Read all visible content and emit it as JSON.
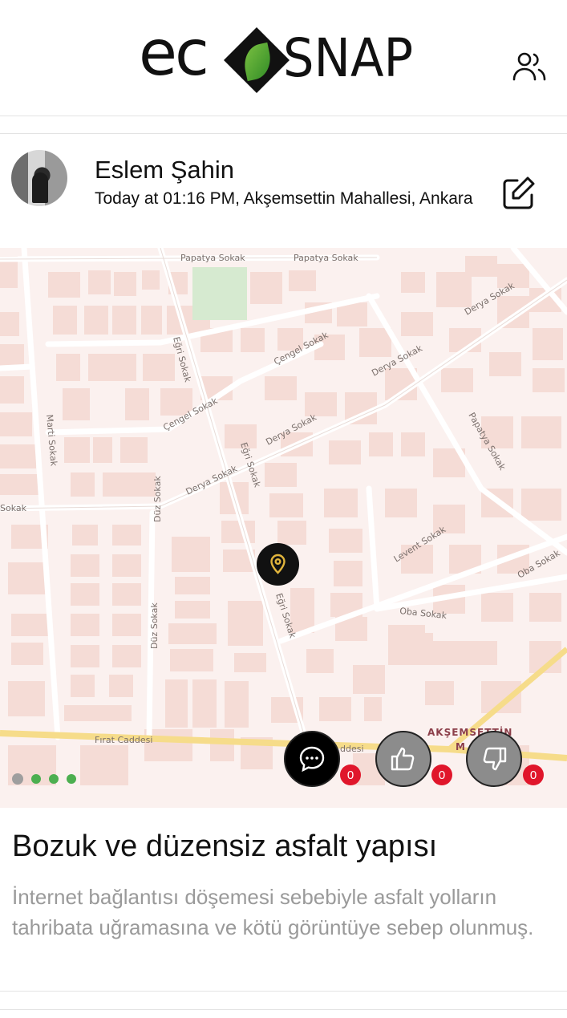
{
  "app": {
    "logo_text": "ecoSNAP"
  },
  "header": {
    "users_icon": "users-icon"
  },
  "post": {
    "author": "Eslem Şahin",
    "meta": "Today at 01:16 PM, Akşemsettin Mahallesi, Ankara",
    "edit_icon": "edit-icon",
    "title": "Bozuk ve düzensiz asfalt yapısı",
    "description": "İnternet bağlantısı döşemesi sebebiyle asfalt yolların tahribata uğramasına ve kötü görüntüye sebep olunmuş."
  },
  "map": {
    "streets": [
      "Papatya Sokak",
      "Papatya Sokak",
      "Derya Sokak",
      "Eğri Sokak",
      "Çengel Sokak",
      "Derya Sokak",
      "Çengel Sokak",
      "Marti Sokak",
      "Derya Sokak",
      "Derya Sokak",
      "Eğri Sokak",
      "Papatya Sokak",
      "Sokak",
      "Düz Sokak",
      "Levent Sokak",
      "Oba Sokak",
      "Düz Sokak",
      "Eğri Sokak",
      "Oba Sokak",
      "Fırat Caddesi",
      "ddesi"
    ],
    "district": "AKŞEMSETTİN",
    "district_line2": "M",
    "pin_icon": "location-pin-icon",
    "colors": {
      "background": "#fbf1ef",
      "building": "#f5dcd6",
      "road": "#ffffff",
      "park": "#d6ead0",
      "main_road": "#f6dc8a"
    }
  },
  "actions": {
    "comment_icon": "comment-icon",
    "comment_count": "0",
    "like_icon": "thumbs-up-icon",
    "like_count": "0",
    "dislike_icon": "thumbs-down-icon",
    "dislike_count": "0"
  },
  "carousel": {
    "dots": 4,
    "active_index": 0
  },
  "colors": {
    "badge": "#e0162b",
    "brand_green": "#4caf50",
    "pin_gold": "#e0b43c"
  }
}
